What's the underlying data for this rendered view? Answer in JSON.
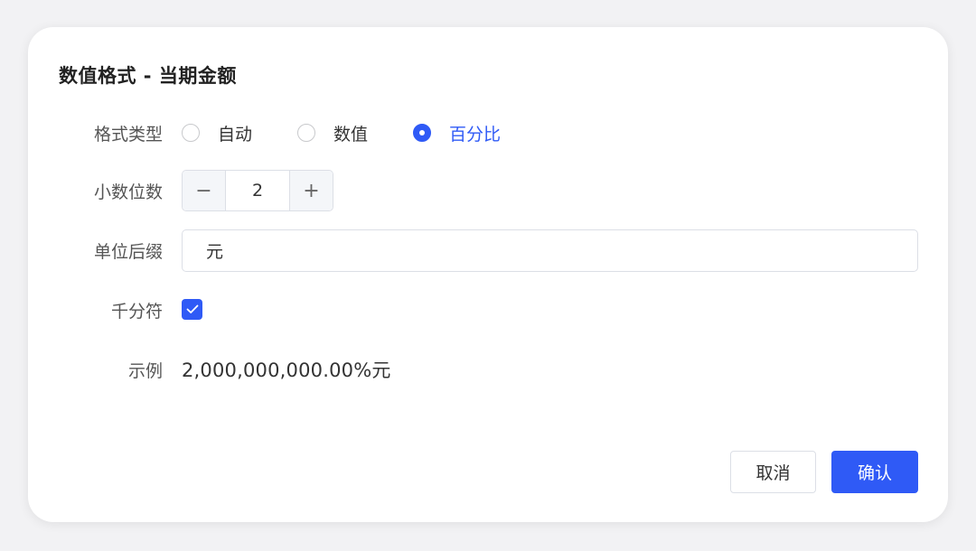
{
  "dialog": {
    "title": "数值格式 - 当期金额"
  },
  "format_type": {
    "label": "格式类型",
    "options": [
      "自动",
      "数值",
      "百分比"
    ],
    "selected": "百分比"
  },
  "decimal_places": {
    "label": "小数位数",
    "minus_symbol": "−",
    "value": "2",
    "plus_symbol": "+"
  },
  "unit_suffix": {
    "label": "单位后缀",
    "value": "元"
  },
  "thousands_separator": {
    "label": "千分符",
    "checked": true
  },
  "example": {
    "label": "示例",
    "value": "2,000,000,000.00%元"
  },
  "buttons": {
    "cancel": "取消",
    "confirm": "确认"
  },
  "colors": {
    "accent": "#2f5af6"
  },
  "icons": {
    "checkbox": "check-icon"
  }
}
